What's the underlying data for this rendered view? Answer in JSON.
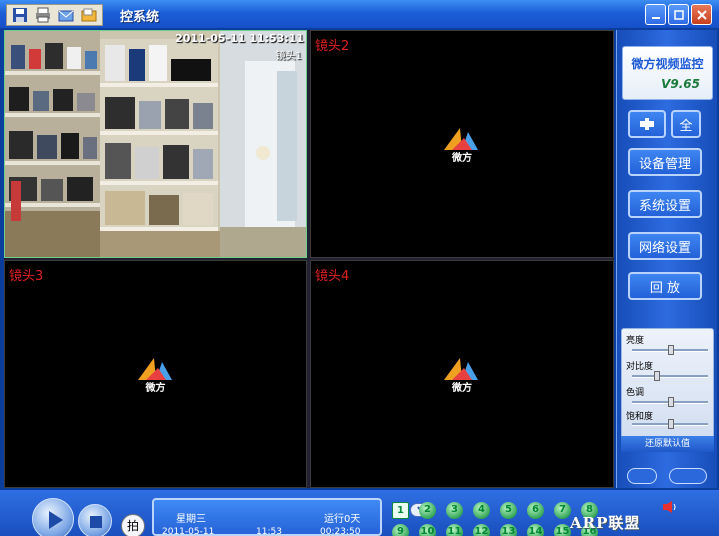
{
  "window": {
    "title": "控系统",
    "min_icon": "minimize-icon",
    "max_icon": "maximize-icon",
    "close_icon": "close-icon"
  },
  "quick_tools": [
    "save-icon",
    "print-icon",
    "mail-icon",
    "folder-icon"
  ],
  "cameras": [
    {
      "label": "",
      "osd_time": "2011-05-11 11:53:11",
      "osd_cam": "镜头1",
      "live": true
    },
    {
      "label": "镜头2",
      "live": false
    },
    {
      "label": "镜头3",
      "live": false
    },
    {
      "label": "镜头4",
      "live": false
    }
  ],
  "logo": {
    "text": "微方"
  },
  "side": {
    "brand": "微方视频监控",
    "version": "V9.65",
    "top_buttons": [
      "pin-icon",
      "全"
    ],
    "buttons": [
      "设备管理",
      "系统设置",
      "网络设置",
      "回 放"
    ],
    "sliders": [
      {
        "label": "亮度",
        "value": 0.5
      },
      {
        "label": "对比度",
        "value": 0.3
      },
      {
        "label": "色调",
        "value": 0.5
      },
      {
        "label": "饱和度",
        "value": 0.5
      }
    ],
    "reset": "还原默认值"
  },
  "bottom": {
    "snap_label": "拍",
    "weekday": "星期三",
    "run_label": "运行0天",
    "date": "2011-05-11",
    "time": "11:53",
    "runtime": "00:23:50",
    "channels_row1": [
      "1",
      "2",
      "3",
      "4",
      "5",
      "6",
      "7",
      "8"
    ],
    "channels_row2": [
      "9",
      "10",
      "11",
      "12",
      "13",
      "14",
      "15",
      "16"
    ],
    "watermark": "ARP联盟"
  },
  "colors": {
    "accent": "#1c5fd8",
    "label_red": "#e02020",
    "channel_green": "#33a657"
  }
}
